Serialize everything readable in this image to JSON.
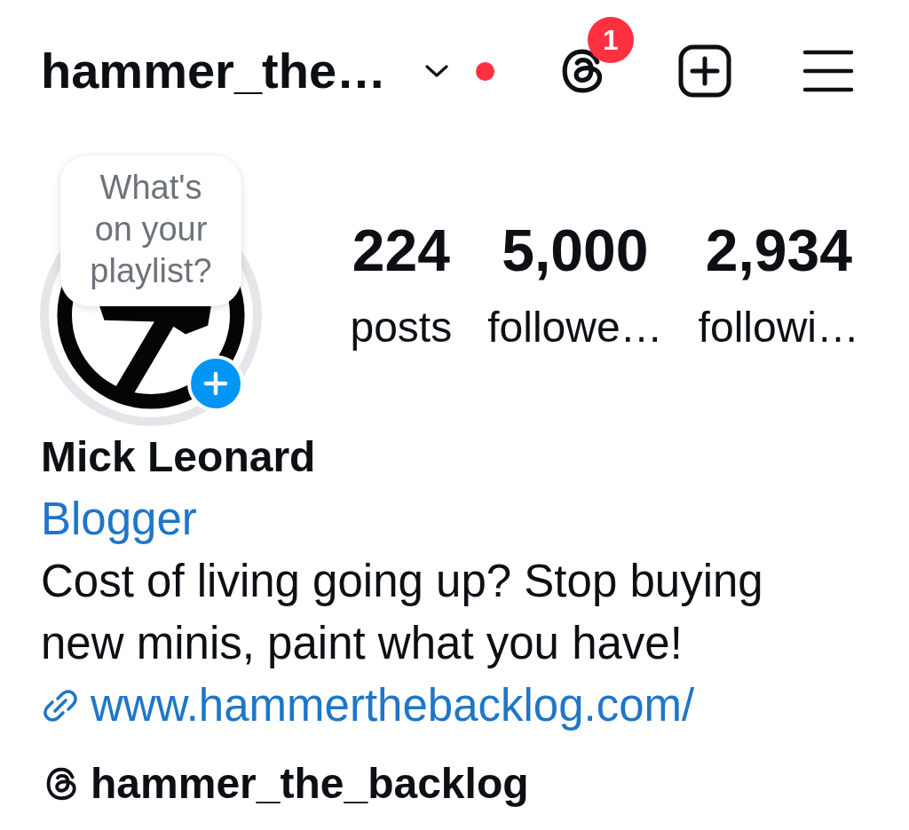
{
  "header": {
    "username": "hammer_the…",
    "new_activity_dot": true,
    "threads_badge": "1"
  },
  "profile": {
    "note": "What's on your playlist?",
    "stats": [
      {
        "count": "224",
        "label": "posts"
      },
      {
        "count": "5,000",
        "label": "followe…"
      },
      {
        "count": "2,934",
        "label": "followi…"
      }
    ],
    "name": "Mick Leonard",
    "category": "Blogger",
    "bio": "Cost of living going up? Stop buying new minis, paint what you have!",
    "link": "www.hammerthebacklog.com/",
    "threads_handle": "hammer_the_backlog"
  }
}
